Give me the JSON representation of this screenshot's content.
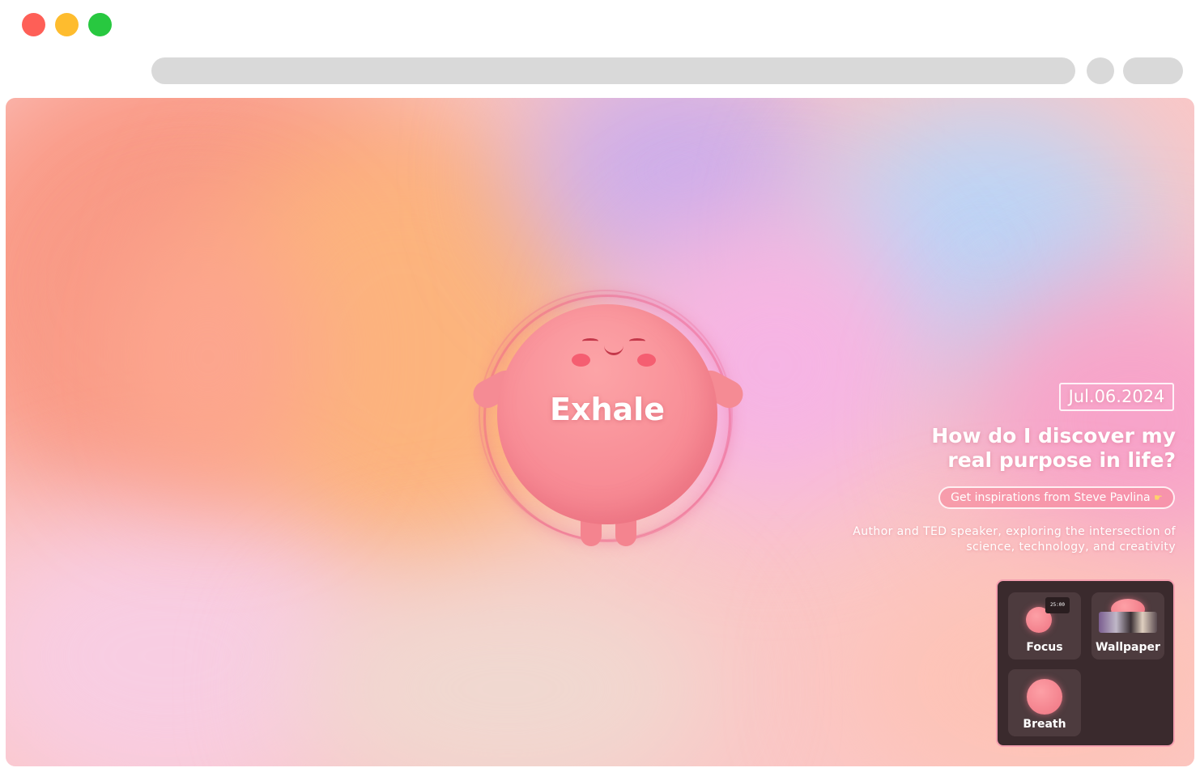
{
  "browser": {
    "window_controls": [
      "close",
      "minimize",
      "maximize"
    ]
  },
  "main": {
    "character_caption": "Exhale",
    "date": "Jul.06.2024",
    "headline": "How do I discover my real purpose in life?",
    "inspiration_button": "Get inspirations from Steve Pavlina",
    "inspiration_icon": "pointing-hand-icon",
    "author_description": "Author and TED speaker, exploring the intersection of science, technology, and creativity"
  },
  "apps": [
    {
      "label": "Focus",
      "icon": "focus-app-icon",
      "timer_text": "25:00"
    },
    {
      "label": "Wallpaper",
      "icon": "wallpaper-app-icon"
    },
    {
      "label": "Breath",
      "icon": "breath-app-icon"
    }
  ],
  "colors": {
    "accent_pink": "#f88d96",
    "panel_background": "#3a2a2d",
    "tile_background": "#4d3b3e",
    "close": "#fe5f57",
    "minimize": "#febc2e",
    "maximize": "#28c840"
  }
}
